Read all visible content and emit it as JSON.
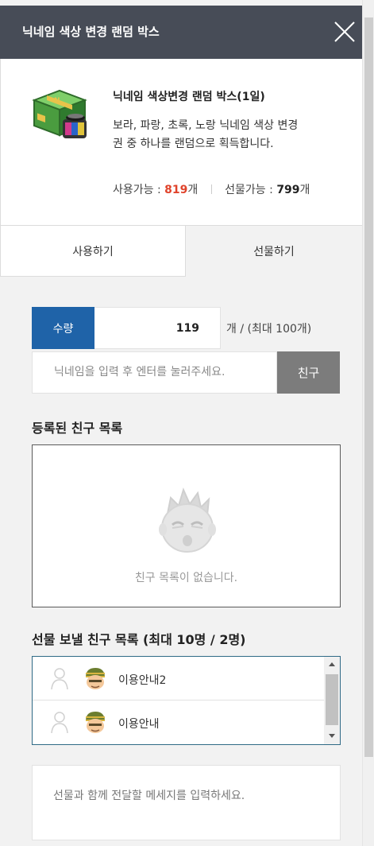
{
  "header": {
    "title": "닉네임 색상 변경 랜덤 박스"
  },
  "product": {
    "name": "닉네임 색상변경 랜덤 박스(1일)",
    "description": "보라, 파랑, 초록, 노랑 닉네임 색상 변경권 중 하나를 랜덤으로 획득합니다.",
    "usable_label": "사용가능 : ",
    "usable_count": "819",
    "unit": "개",
    "giftable_label": "선물가능 : ",
    "giftable_count": "799"
  },
  "tabs": {
    "use": "사용하기",
    "gift": "선물하기"
  },
  "quantity": {
    "label": "수량",
    "value": "119",
    "suffix": "개 / (최대 100개)"
  },
  "nickname": {
    "placeholder": "닉네임을 입력 후 엔터를 눌러주세요.",
    "button": "친구"
  },
  "registered_friends": {
    "title": "등록된 친구 목록",
    "empty_text": "친구 목록이 없습니다."
  },
  "send_list": {
    "title": "선물 보낼 친구 목록 (최대 10명 / 2명)",
    "items": [
      {
        "name": "이용안내2"
      },
      {
        "name": "이용안내"
      }
    ]
  },
  "message": {
    "placeholder": "선물과 함께 전달할 메세지를 입력하세요."
  },
  "colors": {
    "header_bg": "#474c57",
    "accent_blue": "#1f63a8",
    "count_red": "#e0432b",
    "button_gray": "#7c7c7c"
  }
}
